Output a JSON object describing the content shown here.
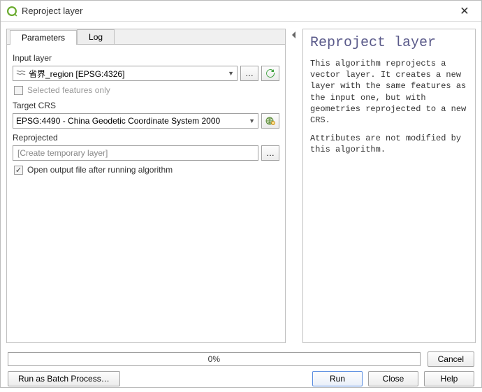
{
  "titlebar": {
    "title": "Reproject layer"
  },
  "tabs": {
    "parameters": "Parameters",
    "log": "Log"
  },
  "form": {
    "input_layer_label": "Input layer",
    "input_layer_value": "省界_region [EPSG:4326]",
    "selected_only_label": "Selected features only",
    "target_crs_label": "Target CRS",
    "target_crs_value": "EPSG:4490 - China Geodetic Coordinate System 2000",
    "output_label": "Reprojected",
    "output_placeholder": "[Create temporary layer]",
    "open_output_label": "Open output file after running algorithm",
    "open_output_checked": true,
    "browse": "…"
  },
  "help": {
    "title": "Reproject layer",
    "p1": "This algorithm reprojects a vector layer. It creates a new layer with the same features as the input one, but with geometries reprojected to a new CRS.",
    "p2": "Attributes are not modified by this algorithm."
  },
  "footer": {
    "progress": "0%",
    "cancel": "Cancel",
    "batch": "Run as Batch Process…",
    "run": "Run",
    "close": "Close",
    "help": "Help"
  },
  "icons": {
    "reload": "reload-icon",
    "globe": "crs-globe-icon",
    "layer": "layer-icon",
    "qgis": "qgis-icon"
  }
}
